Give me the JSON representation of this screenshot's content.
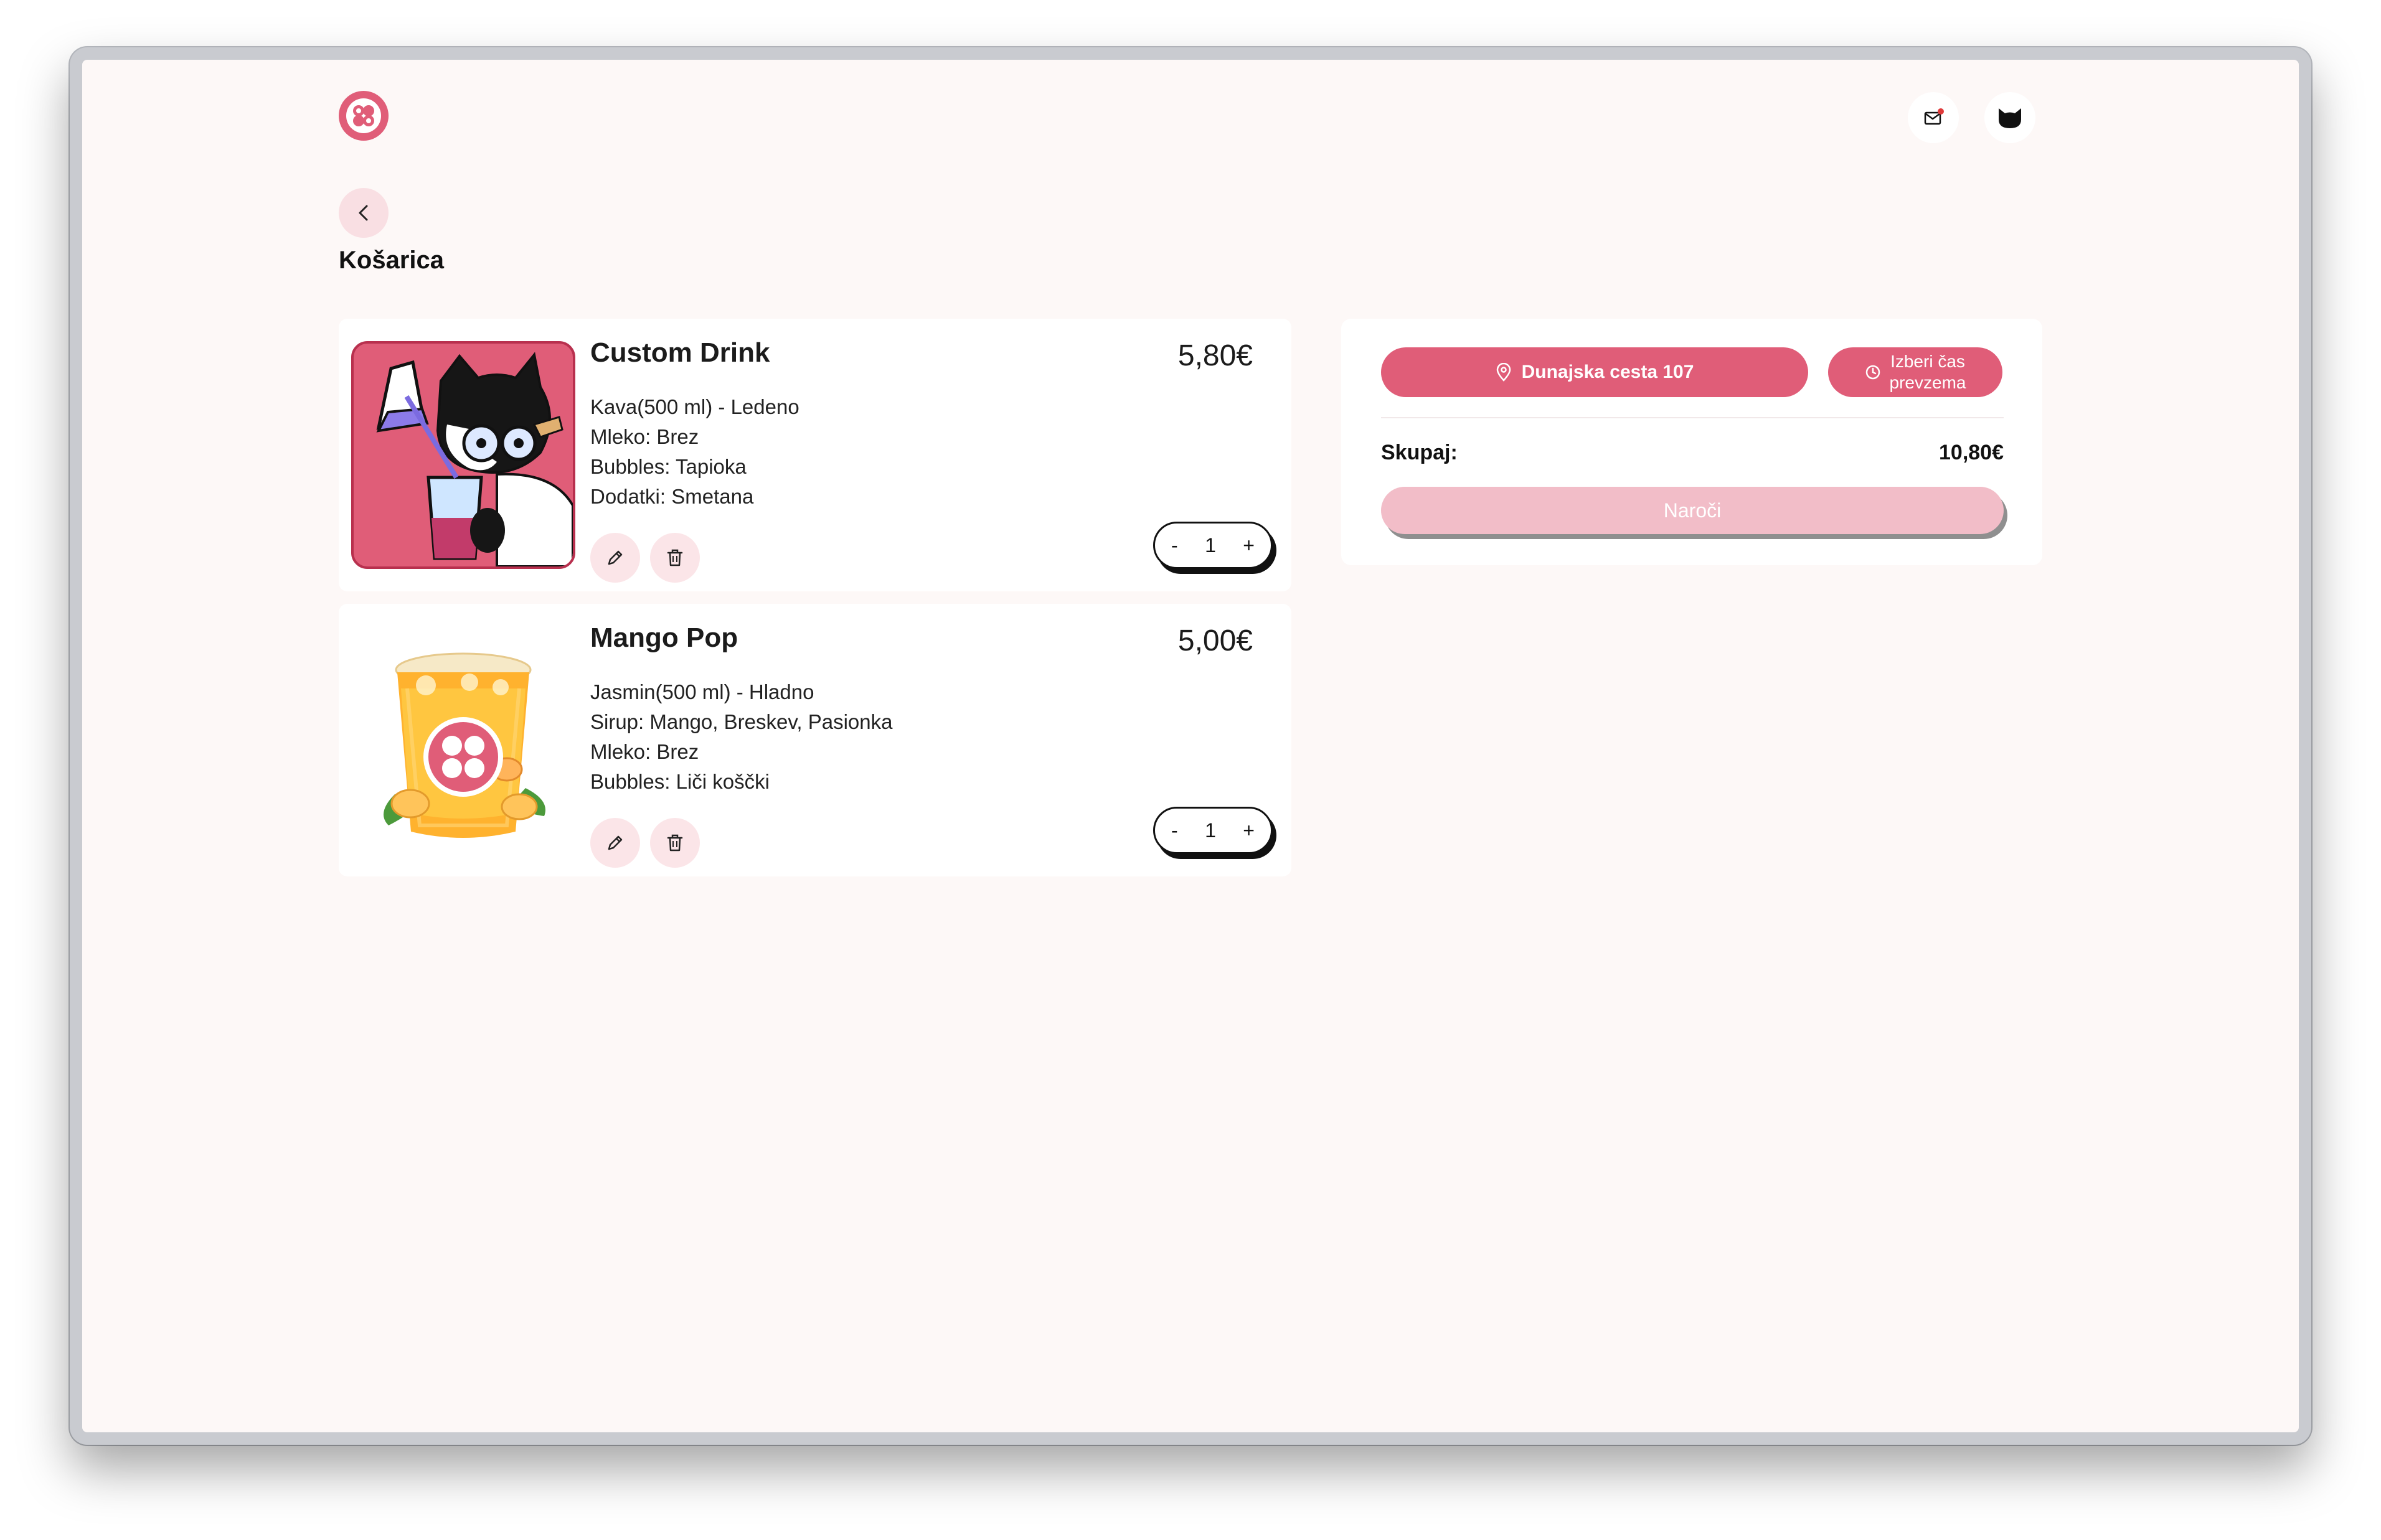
{
  "colors": {
    "accent": "#e05d78",
    "accent_light": "#f2bdc8",
    "page_background": "#fdf8f7",
    "button_soft": "#fbe5e8"
  },
  "header": {
    "logo_icon": "bubble-logo-icon",
    "notification_icon": "mail-notification-icon",
    "profile_icon": "cat-avatar-icon"
  },
  "page": {
    "back_icon": "chevron-left-icon",
    "title": "Košarica"
  },
  "cart": {
    "items": [
      {
        "name": "Custom Drink",
        "price": "5,80€",
        "details": [
          "Kava(500 ml) - Ledeno",
          "Mleko: Brez",
          "Bubbles: Tapioka",
          "Dodatki: Smetana"
        ],
        "quantity": "1",
        "minus": "-",
        "plus": "+",
        "image_icon": "cat-scientist-drink-image"
      },
      {
        "name": "Mango Pop",
        "price": "5,00€",
        "details": [
          "Jasmin(500 ml) - Hladno",
          "Sirup: Mango, Breskev, Pasionka",
          "Mleko: Brez",
          "Bubbles: Liči koščki"
        ],
        "quantity": "1",
        "minus": "-",
        "plus": "+",
        "image_icon": "mango-drink-image"
      }
    ]
  },
  "summary": {
    "location_label": "Dunajska cesta 107",
    "time_label_line1": "Izberi čas",
    "time_label_line2": "prevzema",
    "total_label": "Skupaj:",
    "total_value": "10,80€",
    "order_label": "Naroči"
  }
}
